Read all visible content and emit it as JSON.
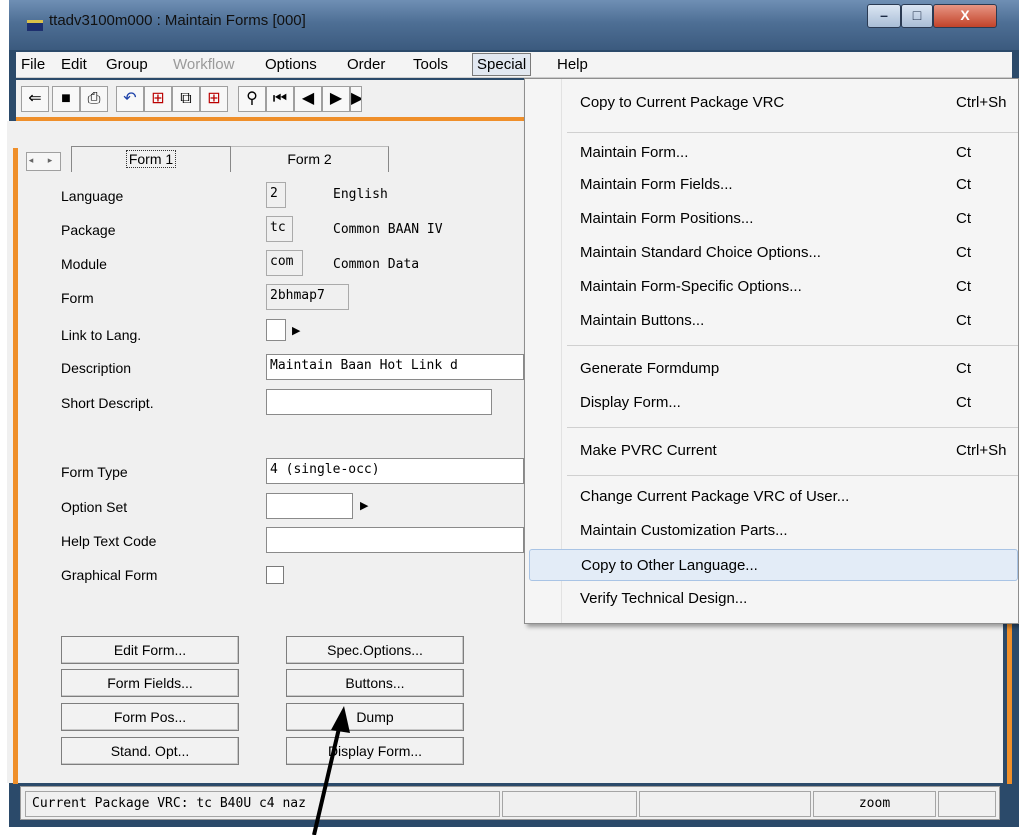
{
  "window": {
    "title": "ttadv3100m000 : Maintain Forms [000]",
    "btn_min": "–",
    "btn_max": "□",
    "btn_close": "X"
  },
  "menubar": {
    "file": "File",
    "edit": "Edit",
    "group": "Group",
    "workflow": "Workflow",
    "options": "Options",
    "order": "Order",
    "tools": "Tools",
    "special": "Special",
    "help": "Help"
  },
  "tabs": {
    "arrows": "◂ ▸",
    "tab1": "Form 1",
    "tab2": "Form 2"
  },
  "fields": {
    "language_label": "Language",
    "language_code": "2",
    "language_desc": "English",
    "package_label": "Package",
    "package_code": "tc",
    "package_desc": "Common BAAN IV",
    "module_label": "Module",
    "module_code": "com",
    "module_desc": "Common Data",
    "form_label": "Form",
    "form_value": "2bhmap7",
    "link_label": "Link to Lang.",
    "description_label": "Description",
    "description_value": "Maintain Baan Hot Link d",
    "short_label": "Short Descript.",
    "short_value": "",
    "formtype_label": "Form Type",
    "formtype_value": "4 (single-occ)",
    "optionset_label": "Option Set",
    "optionset_value": "",
    "helptext_label": "Help Text Code",
    "helptext_value": "",
    "graphical_label": "Graphical Form"
  },
  "buttons": {
    "edit_form": "Edit Form...",
    "form_fields": "Form Fields...",
    "form_pos": "Form Pos...",
    "stand_opt": "Stand. Opt...",
    "spec_options": "Spec.Options...",
    "buttons": "Buttons...",
    "dump": "Dump",
    "display_form": "Display Form..."
  },
  "status": {
    "vrc": "Current Package VRC: tc B40U c4 naz",
    "cell2": "",
    "cell3": "",
    "zoom": "zoom",
    "cell5": ""
  },
  "special_menu": {
    "copy_vrc": "Copy to Current Package VRC",
    "copy_vrc_sc": "Ctrl+Sh",
    "maint_form": "Maintain Form...",
    "maint_form_sc": "Ct",
    "maint_fields": "Maintain Form Fields...",
    "maint_fields_sc": "Ct",
    "maint_positions": "Maintain Form Positions...",
    "maint_positions_sc": "Ct",
    "maint_choice": "Maintain Standard Choice Options...",
    "maint_choice_sc": "Ct",
    "maint_specific": "Maintain Form-Specific Options...",
    "maint_specific_sc": "Ct",
    "maint_buttons": "Maintain Buttons...",
    "maint_buttons_sc": "Ct",
    "gen_dump": "Generate Formdump",
    "gen_dump_sc": "Ct",
    "display_form": "Display Form...",
    "display_form_sc": "Ct",
    "make_pvrc": "Make PVRC Current",
    "make_pvrc_sc": "Ctrl+Sh",
    "change_vrc": "Change Current Package VRC of User...",
    "maint_custom": "Maintain Customization Parts...",
    "copy_lang": "Copy to Other Language...",
    "verify": "Verify Technical Design..."
  },
  "colors": {
    "accent_orange": "#ef8f2a",
    "highlight": "#e3ecf7"
  }
}
